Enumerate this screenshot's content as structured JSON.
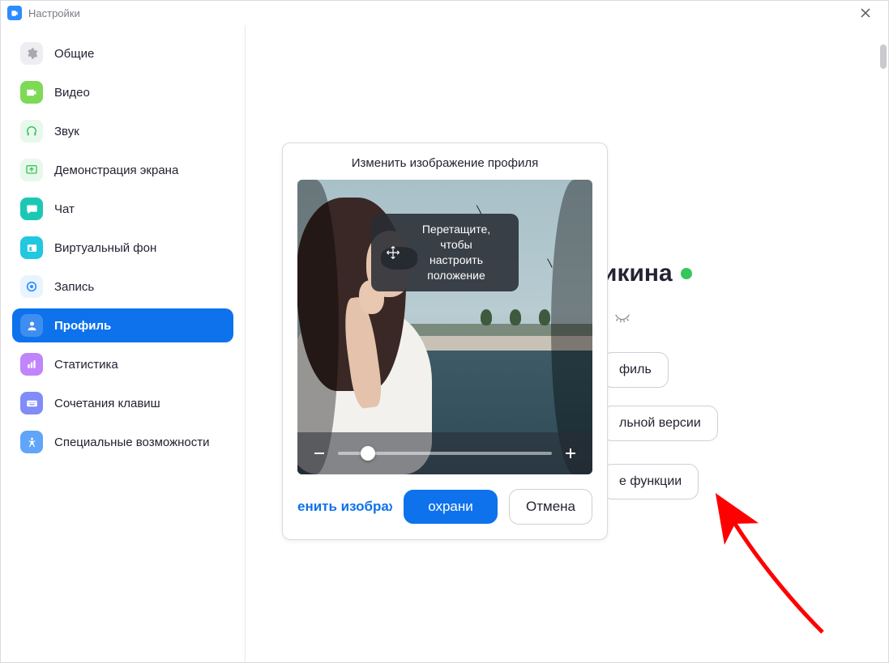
{
  "window": {
    "title": "Настройки"
  },
  "sidebar": {
    "items": [
      {
        "label": "Общие",
        "icon": "gear",
        "color": "#e9e9ef",
        "fg": "#a8a8b0"
      },
      {
        "label": "Видео",
        "icon": "video",
        "color": "#7ed957",
        "fg": "#ffffff"
      },
      {
        "label": "Звук",
        "icon": "headphones",
        "color": "#e8f8ec",
        "fg": "#34c759"
      },
      {
        "label": "Демонстрация экрана",
        "icon": "share",
        "color": "#e8f8ec",
        "fg": "#34c759"
      },
      {
        "label": "Чат",
        "icon": "chat",
        "color": "#2dd4bf",
        "fg": "#ffffff"
      },
      {
        "label": "Виртуальный фон",
        "icon": "id",
        "color": "#22d3ee",
        "fg": "#ffffff"
      },
      {
        "label": "Запись",
        "icon": "record",
        "color": "#e8f4ff",
        "fg": "#2d8cff"
      },
      {
        "label": "Профиль",
        "icon": "person",
        "color": "#ffffff",
        "fg": "#ffffff",
        "active": true
      },
      {
        "label": "Статистика",
        "icon": "stats",
        "color": "#c084fc",
        "fg": "#ffffff"
      },
      {
        "label": "Сочетания клавиш",
        "icon": "keyboard",
        "color": "#818cf8",
        "fg": "#ffffff"
      },
      {
        "label": "Специальные возможности",
        "icon": "a11y",
        "color": "#60a5fa",
        "fg": "#ffffff"
      }
    ]
  },
  "profile": {
    "name_fragment": "икина",
    "status": "online",
    "buttons": {
      "edit_profile_fragment": "филь",
      "full_version_fragment": "льной версии",
      "features_fragment": "е функции"
    }
  },
  "modal": {
    "title": "Изменить изображение профиля",
    "drag_hint_line1": "Перетащите, чтобы",
    "drag_hint_line2": "настроить положение",
    "change_image_fragment": "енить изображ",
    "save_fragment": "охрани",
    "cancel": "Отмена"
  }
}
